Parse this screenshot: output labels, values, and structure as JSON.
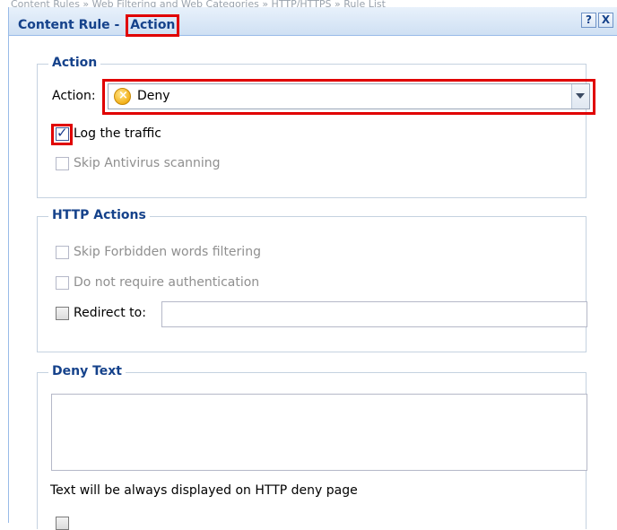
{
  "background": {
    "breadcrumb": "Content Rules  »  Web Filtering and Web Categories  »  HTTP/HTTPS  »  Rule List"
  },
  "dialog": {
    "title_prefix": "Content Rule - ",
    "title_current": "Action",
    "help_button": "?",
    "close_button": "X"
  },
  "action_section": {
    "legend": "Action",
    "action_label": "Action:",
    "action_value": "Deny",
    "action_icon": "deny-icon",
    "log_traffic_label": "Log the traffic",
    "log_traffic_checked": true,
    "skip_antivirus_label": "Skip Antivirus scanning"
  },
  "http_section": {
    "legend": "HTTP Actions",
    "skip_forbidden_label": "Skip Forbidden words filtering",
    "no_auth_label": "Do not require authentication",
    "redirect_label": "Redirect to:",
    "redirect_value": ""
  },
  "deny_section": {
    "legend": "Deny Text",
    "deny_text_value": "",
    "note": "Text will be always displayed on HTTP deny page"
  },
  "colors": {
    "highlight": "#e00000",
    "title_text": "#15428b",
    "border": "#99bbe8"
  }
}
